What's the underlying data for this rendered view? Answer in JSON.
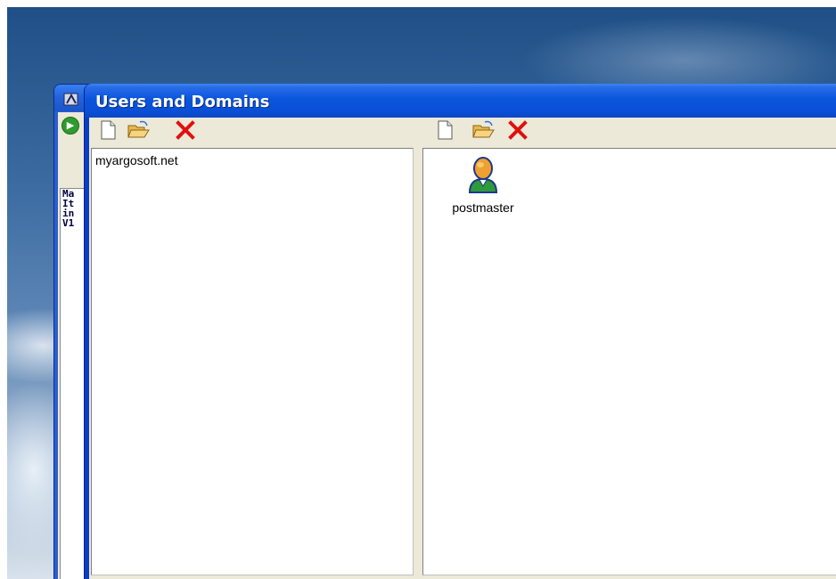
{
  "window": {
    "title": "Users and Domains"
  },
  "domains_toolbar": {
    "new_icon": "new-document-icon",
    "open_icon": "open-folder-icon",
    "delete_icon": "delete-x-icon"
  },
  "users_toolbar": {
    "new_icon": "new-document-icon",
    "open_icon": "open-folder-icon",
    "delete_icon": "delete-x-icon"
  },
  "domains": [
    {
      "name": "myargosoft.net"
    }
  ],
  "users": [
    {
      "name": "postmaster",
      "icon": "user-icon"
    }
  ],
  "background_window": {
    "console_lines": [
      "Ma",
      "It",
      "in",
      "V1"
    ]
  },
  "colors": {
    "titlebar": "#0a55dc",
    "delete_red": "#e01010"
  }
}
